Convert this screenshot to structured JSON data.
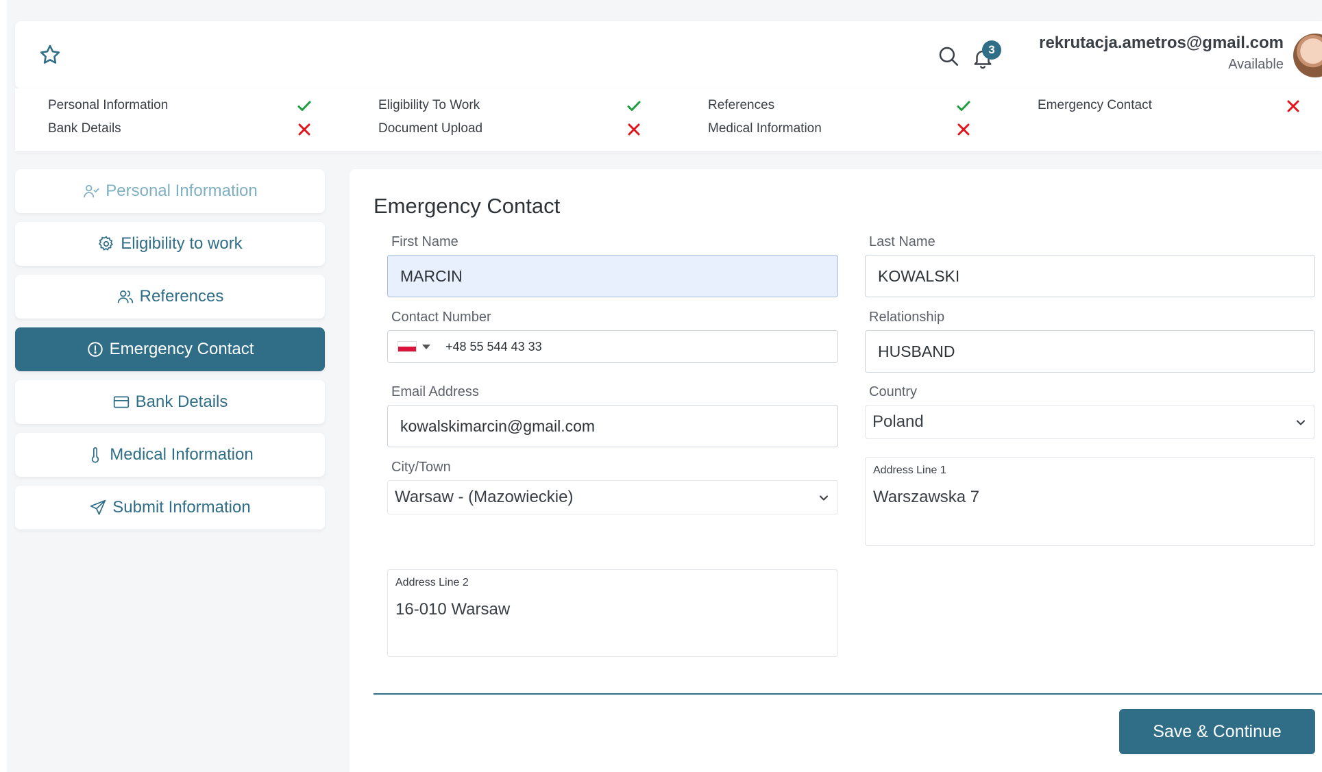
{
  "header": {
    "user_email": "rekrutacja.ametros@gmail.com",
    "user_status": "Available",
    "notification_count": "3"
  },
  "status_bar": {
    "items": [
      {
        "label": "Personal Information",
        "done": true
      },
      {
        "label": "Bank Details",
        "done": false
      },
      {
        "label": "Eligibility To Work",
        "done": true
      },
      {
        "label": "Document Upload",
        "done": false
      },
      {
        "label": "References",
        "done": true
      },
      {
        "label": "Medical Information",
        "done": false
      },
      {
        "label": "Emergency Contact",
        "done": false
      }
    ]
  },
  "sidebar": {
    "items": [
      {
        "label": "Personal Information",
        "icon": "user-check-icon"
      },
      {
        "label": "Eligibility to work",
        "icon": "gear-icon"
      },
      {
        "label": "References",
        "icon": "users-icon"
      },
      {
        "label": "Emergency Contact",
        "icon": "alert-circle-icon",
        "active": true
      },
      {
        "label": "Bank Details",
        "icon": "credit-card-icon"
      },
      {
        "label": "Medical  Information",
        "icon": "thermometer-icon"
      },
      {
        "label": "Submit Information",
        "icon": "send-icon"
      }
    ]
  },
  "form": {
    "title": "Emergency Contact",
    "first_name_label": "First Name",
    "first_name_value": "MARCIN",
    "last_name_label": "Last Name",
    "last_name_value": "KOWALSKI",
    "contact_label": "Contact Number",
    "contact_value": "+48 55 544 43 33",
    "relationship_label": "Relationship",
    "relationship_value": "HUSBAND",
    "email_label": "Email Address",
    "email_value": "kowalskimarcin@gmail.com",
    "country_label": "Country",
    "country_value": "Poland",
    "city_label": "City/Town",
    "city_value": "Warsaw - (Mazowieckie)",
    "address1_label": "Address Line 1",
    "address1_value": "Warszawska 7",
    "address2_label": "Address Line 2",
    "address2_value": "16-010 Warsaw",
    "save_label": "Save & Continue"
  },
  "colors": {
    "accent": "#2f6e86",
    "check": "#1e9e3e",
    "cross": "#e0151b"
  }
}
